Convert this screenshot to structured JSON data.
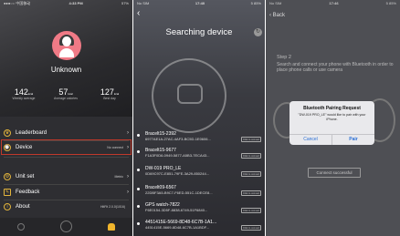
{
  "p1": {
    "status": {
      "left": "●●●○○ 中国移动",
      "time": "4:33 PM",
      "right": "57%"
    },
    "username": "Unknown",
    "stats": [
      {
        "value": "142",
        "unit": "kcal",
        "label": "Weekly average"
      },
      {
        "value": "57",
        "unit": "kcal",
        "label": "Average calories"
      },
      {
        "value": "127",
        "unit": "kcal",
        "label": "Best day"
      }
    ],
    "menu": {
      "leaderboard": "Leaderboard",
      "device": "Device",
      "device_value": "No connect",
      "unit": "Unit set",
      "unit_value": "Metric",
      "feedback": "Feedback",
      "about": "About",
      "about_value": "HitFit 2.0.0(1016)"
    }
  },
  "p2": {
    "status": {
      "left": "No SIM",
      "time": "17:40",
      "right": "5 85%"
    },
    "title": "Searching device",
    "connect_label": "Click to connect",
    "devices": [
      {
        "name": "Bracelt15-2392",
        "mac": "6977AE1A-27AC-4AF3-BC5D-1E0606..."
      },
      {
        "name": "Bracelt15-9677",
        "mac": "F1A3F0D6-0949-5877-A5B3-7ECA43..."
      },
      {
        "name": "DW-019 PRO_LE",
        "mac": "0D69C97C-E851-79FE-3A29-850244..."
      },
      {
        "name": "Bracelt09-6567",
        "mac": "22DBF3A5-B9C7-F6ED-551C-1DECE8..."
      },
      {
        "name": "GPS watch-7822",
        "mac": "F6E0154-3D5F-8838-6749-51F6840..."
      },
      {
        "name": "4451415E-5669-8D48-6C7B-1A1...",
        "mac": "4451415E-5669-8D48-6C7B-1A1BDF..."
      }
    ]
  },
  "p3": {
    "status": {
      "left": "No SIM",
      "time": "17:46",
      "right": "5 85%"
    },
    "back": "Back",
    "step_title": "Step 2",
    "step_desc": "Search and connect your phone with Bluetooth in order to place phone calls or use camera",
    "dialog": {
      "title": "Bluetooth Pairing Request",
      "message": "\"DW-019 PRO_LE\" would like to pair with your iPhone.",
      "cancel": "Cancel",
      "pair": "Pair"
    },
    "connect_btn": "Connect successful"
  }
}
